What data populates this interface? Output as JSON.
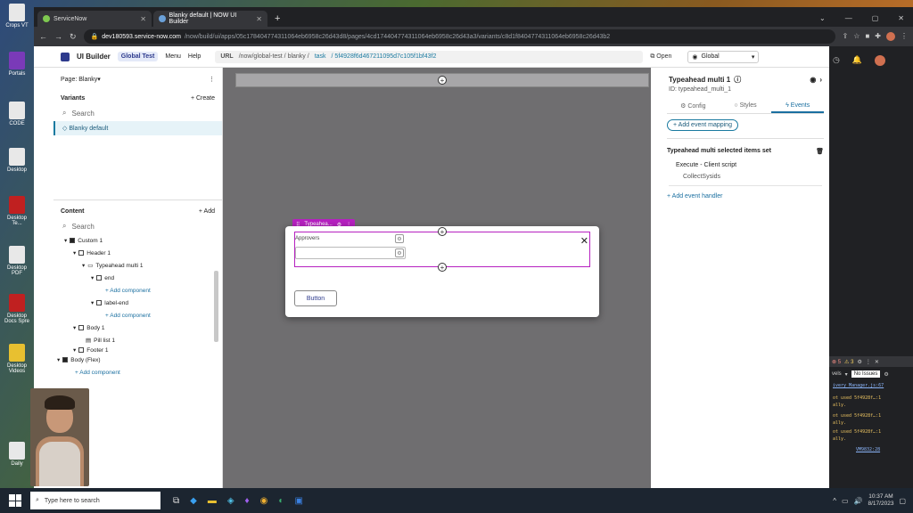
{
  "desktop": {
    "icons": [
      "Crops VT",
      "Portals",
      "CODE",
      "Desktop",
      "Desktop Te...",
      "Desktop PDF",
      "Desktop Docs Spre",
      "Desktop Videos",
      "Daily"
    ]
  },
  "browser": {
    "tabs": [
      {
        "label": "ServiceNow"
      },
      {
        "label": "Blanky default | NOW UI Builder"
      }
    ],
    "url_host": "dev180593.service-now.com",
    "url_path": "/now/build/ui/apps/05c178404774311064eb6958c26d43d8/pages/4cd174404774311064eb6958c26d43a3/variants/c8d1f8404774311064eb6958c26d43b2"
  },
  "header": {
    "app_title": "UI Builder",
    "scope_badge": "Global Test",
    "menu": "Menu",
    "help": "Help",
    "url_label": "URL",
    "url_prefix": "/now/global-test / blanky /",
    "url_task": "task",
    "url_sysid": "/ 5f4928f6d467211095d7c105f1bf43f2",
    "open_label": "Open",
    "scope_select": "Global"
  },
  "left": {
    "page_label": "Page: Blanky",
    "variants_label": "Variants",
    "create_label": "+ Create",
    "search_placeholder": "Search",
    "variant_item": "Blanky default",
    "content_label": "Content",
    "add_label": "+ Add",
    "content_search": "Search",
    "tree": [
      "Custom 1",
      "Header 1",
      "Typeahead multi 1",
      "end",
      "+ Add component",
      "label-end",
      "+ Add component",
      "Body 1",
      "Pill list 1",
      "Footer 1",
      "Body (Flex)",
      "+ Add component"
    ]
  },
  "canvas": {
    "selected_label": "Typeahea...",
    "field_label": "Approvers",
    "button_label": "Button"
  },
  "right": {
    "title": "Typeahead multi 1",
    "id": "ID: typeahead_multi_1",
    "tabs": [
      "Config",
      "Styles",
      "Events"
    ],
    "add_event_mapping": "+ Add event mapping",
    "event_name": "Typeahead multi selected items set",
    "handler": "Execute - Client script",
    "handler_sub": "CollectSysids",
    "add_handler": "+ Add event handler"
  },
  "devtools": {
    "errors": "5",
    "warnings": "3",
    "levels": "vels",
    "no_issues": "No Issues",
    "lines": [
      {
        "text": "ivery_Manager.js:67",
        "kind": "link"
      },
      {
        "text": "ot used 5f4928f…:1",
        "kind": "warn"
      },
      {
        "text": "ally.",
        "kind": "warn"
      },
      {
        "text": "ot used 5f4928f…:1",
        "kind": "warn"
      },
      {
        "text": "ally.",
        "kind": "warn"
      },
      {
        "text": "ot used 5f4928f…:1",
        "kind": "warn"
      },
      {
        "text": "ally.",
        "kind": "warn"
      },
      {
        "text": "VM9832:28",
        "kind": "link"
      }
    ]
  },
  "taskbar": {
    "search_placeholder": "Type here to search",
    "time": "10:37 AM",
    "date": "8/17/2023"
  }
}
